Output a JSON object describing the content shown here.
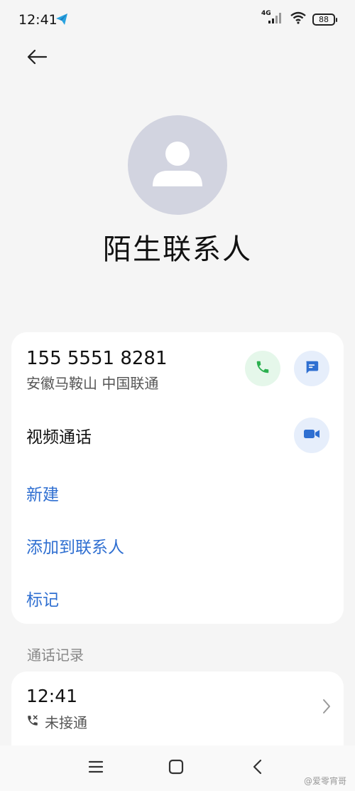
{
  "status_bar": {
    "time": "12:41",
    "app_icon": "telegram-plane-icon",
    "network": "4G",
    "battery": "88"
  },
  "header": {
    "back_icon": "arrow-left-icon"
  },
  "contact": {
    "avatar_icon": "person-silhouette-icon",
    "name": "陌生联系人"
  },
  "number_card": {
    "phone_number": "155 5551 8281",
    "location": "安徽马鞍山 中国联通",
    "call_icon": "phone-icon",
    "message_icon": "message-icon",
    "video_label": "视频通话",
    "video_icon": "video-camera-icon",
    "actions": [
      "新建",
      "添加到联系人",
      "标记"
    ]
  },
  "call_log": {
    "section_title": "通话记录",
    "entries": [
      {
        "time": "12:41",
        "status": "未接通",
        "status_icon": "missed-call-icon"
      }
    ]
  },
  "nav_bar": {
    "menu_icon": "menu-icon",
    "home_icon": "home-square-icon",
    "back_icon": "back-chevron-icon"
  },
  "watermark": "@爱零宵哥",
  "colors": {
    "background": "#f5f5f5",
    "card": "#ffffff",
    "accent_blue": "#2f6fd1",
    "call_green": "#2bb04f",
    "call_bg": "#e5f7ea",
    "blue_bg": "#e6eefb",
    "avatar_bg": "#d2d4e0"
  }
}
